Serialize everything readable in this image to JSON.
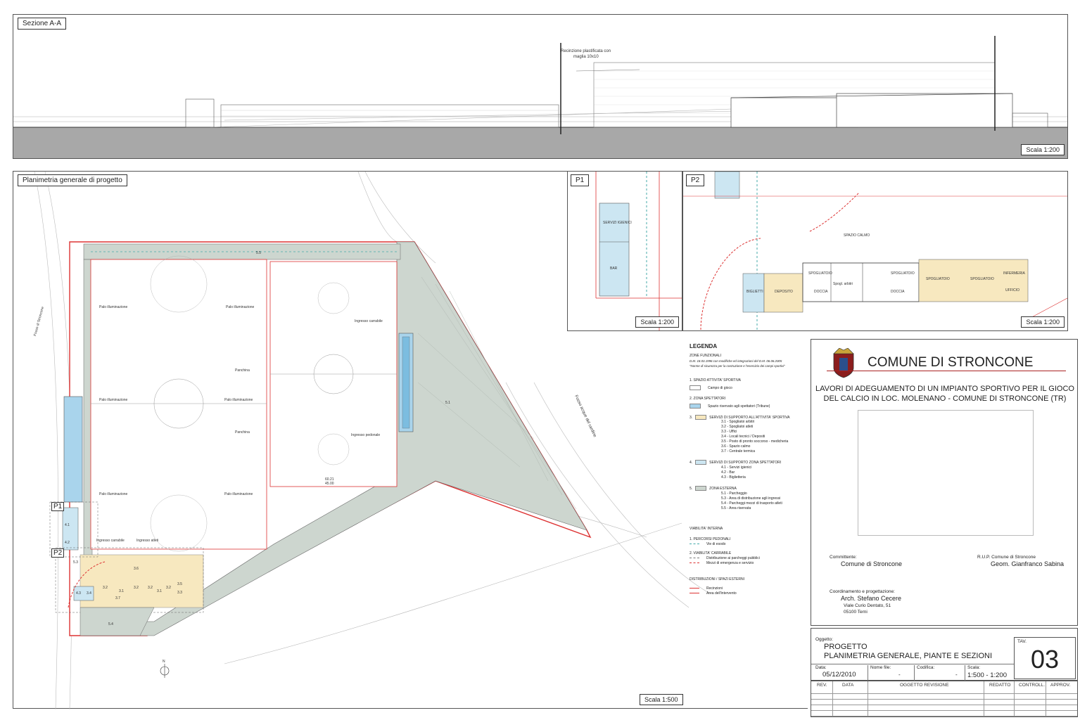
{
  "section": {
    "title": "Sezione A-A",
    "fence_note_1": "Recinzione plastificata con",
    "fence_note_2": "maglia 10x10",
    "scale": "Scala 1:200"
  },
  "site_plan": {
    "title": "Planimetria generale di progetto",
    "scale": "Scala 1:500",
    "labels": {
      "palo": "Palo illuminazione",
      "panchina": "Panchina",
      "ingresso_carrabile": "Ingresso carrabile",
      "ingresso_pedonale": "Ingresso pedonale",
      "ingresso_atleti": "Ingresso atleti",
      "fosso_stroncone": "Fosso di Stroncone",
      "fosso_acque": "Fosso acque del cardine",
      "zone_55": "5.5",
      "zone_51": "5.1",
      "zone_54": "5.4",
      "zone_53": "5.3",
      "zone_41": "4.1",
      "zone_42": "4.2",
      "zone_43": "4.3",
      "zone_34": "3.4",
      "zone_32": "3.2",
      "zone_31": "3.1",
      "zone_35": "3.5",
      "zone_33": "3.3",
      "zone_36": "3.6",
      "zone_37": "3.7",
      "p1": "P1",
      "p2": "P2",
      "north": "N",
      "dim_1": "60.21",
      "dim_2": "45.00"
    }
  },
  "detail_p1": {
    "title": "P1",
    "scale": "Scala 1:200",
    "servizi": "SERVIZI IGIENICI",
    "bar": "BAR"
  },
  "detail_p2": {
    "title": "P2",
    "scale": "Scala 1:200",
    "rooms": {
      "spazio_calmo": "SPAZIO CALMO",
      "biglietti": "BIGLIETTI",
      "deposito": "DEPOSITO",
      "spogliatoio": "SPOGLIATOIO",
      "doccia": "DOCCIA",
      "spogliatoi_arbitri": "Spogl. arbitri",
      "infermeria": "INFERMERIA",
      "ufficio": "UFFICIO"
    }
  },
  "legend": {
    "title": "LEGENDA",
    "subtitle": "ZONE FUNZIONALI",
    "ref_1": "D.M. 18.03.1996 con modifiche ed integrazioni del D.M. 06.06.2005",
    "ref_2": "\"Norme di sicurezza per la costruzione e l'esercizio dei campi sportivi\"",
    "s1_title": "1. SPAZIO ATTIVITA' SPORTIVA",
    "s1_item": "Campo di gioco",
    "s2_title": "2. ZONA SPETTATORI",
    "s2_item": "Spazio riservato agli spettatori (Tribune)",
    "s3_num": "3.",
    "s3_title": "SERVIZI DI SUPPORTO ALL'ATTIVITA' SPORTIVA",
    "s3_items": [
      "3.1 - Spogliatoi arbitri",
      "3.2 - Spogliatoi atleti",
      "3.3 - Uffici",
      "3.4 - Locali tecnici / Depositi",
      "3.5 - Posto di pronto soccorso - medicheria",
      "3.6 - Spazio calmo",
      "3.7 - Centrale termica"
    ],
    "s4_num": "4.",
    "s4_title": "SERVIZI DI SUPPORTO ZONA SPETTATORI",
    "s4_items": [
      "4.1 - Servizi igienici",
      "4.2 - Bar",
      "4.3 - Biglietteria"
    ],
    "s5_num": "5.",
    "s5_title": "ZONA ESTERNA",
    "s5_items": [
      "5.1 - Parcheggio",
      "5.3 - Area di distribuzione agli ingressi",
      "5.4 - Parcheggi mezzi di trasporto atleti",
      "5.5 - Area riservata"
    ],
    "via_title": "VIABILITA' INTERNA",
    "via_1": "1. PERCORSI PEDONALI",
    "via_1_item": "Vie di esodo",
    "via_2": "2. VIABILITA' CARRABILE",
    "via_2_item_1": "Distribuzione ai parcheggi pubblici",
    "via_2_item_2": "Mezzi di emergenza e servizio",
    "dist_title": "DISTRIBUZIONI / SPAZI ESTERNI",
    "dist_1": "Recinzioni",
    "dist_2": "Area dell'intervento"
  },
  "title_block": {
    "municipality": "COMUNE DI STRONCONE",
    "project_line_1": "LAVORI DI ADEGUAMENTO DI UN IMPIANTO SPORTIVO PER IL GIOCO",
    "project_line_2": "DEL CALCIO IN LOC. MOLENANO - COMUNE DI STRONCONE (TR)",
    "committente_label": "Committente:",
    "committente": "Comune di Stroncone",
    "rup_label": "R.U.P. Comune di Stroncone",
    "rup": "Geom. Gianfranco Sabina",
    "coord_label": "Coordinamento e progettazione:",
    "architect": "Arch. Stefano Cecere",
    "address_1": "Viale Curio Dentato, 51",
    "address_2": "05100 Terni",
    "oggetto_label": "Oggetto:",
    "oggetto_1": "PROGETTO",
    "oggetto_2": "PLANIMETRIA GENERALE, PIANTE  E SEZIONI",
    "tav_label": "TAV.",
    "tav": "03",
    "data_label": "Data:",
    "data": "05/12/2010",
    "nome_label": "Nome file:",
    "nome": "-",
    "codifica_label": "Codifica:",
    "codifica": "-",
    "scala_label": "Scala:",
    "scala": "1:500 - 1:200",
    "rev_headers": [
      "REV.",
      "DATA",
      "OGGETTO REVISIONE",
      "REDATTO",
      "CONTROLL.",
      "APPROV."
    ]
  }
}
